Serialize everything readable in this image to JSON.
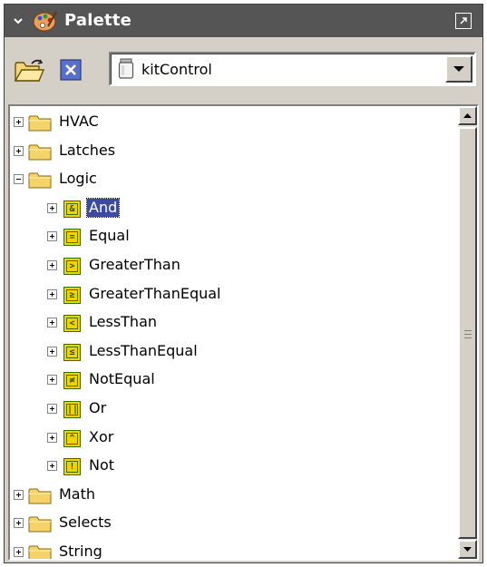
{
  "title_bar": {
    "title": "Palette"
  },
  "toolbar": {
    "module_selected": "kitControl"
  },
  "tree": {
    "items": [
      {
        "label": "HVAC",
        "type": "folder",
        "level": 0,
        "expanded": false
      },
      {
        "label": "Latches",
        "type": "folder",
        "level": 0,
        "expanded": false
      },
      {
        "label": "Logic",
        "type": "folder",
        "level": 0,
        "expanded": true
      },
      {
        "label": "And",
        "type": "component",
        "level": 1,
        "glyph": "&",
        "selected": true
      },
      {
        "label": "Equal",
        "type": "component",
        "level": 1,
        "glyph": "="
      },
      {
        "label": "GreaterThan",
        "type": "component",
        "level": 1,
        "glyph": ">"
      },
      {
        "label": "GreaterThanEqual",
        "type": "component",
        "level": 1,
        "glyph": "≥"
      },
      {
        "label": "LessThan",
        "type": "component",
        "level": 1,
        "glyph": "<"
      },
      {
        "label": "LessThanEqual",
        "type": "component",
        "level": 1,
        "glyph": "≤"
      },
      {
        "label": "NotEqual",
        "type": "component",
        "level": 1,
        "glyph": "≠"
      },
      {
        "label": "Or",
        "type": "component",
        "level": 1,
        "glyph": "||"
      },
      {
        "label": "Xor",
        "type": "component",
        "level": 1,
        "glyph": "^"
      },
      {
        "label": "Not",
        "type": "component",
        "level": 1,
        "glyph": "!"
      },
      {
        "label": "Math",
        "type": "folder",
        "level": 0,
        "expanded": false
      },
      {
        "label": "Selects",
        "type": "folder",
        "level": 0,
        "expanded": false
      },
      {
        "label": "String",
        "type": "folder",
        "level": 0,
        "expanded": false
      }
    ]
  },
  "colors": {
    "titlebar": "#555555",
    "panel": "#d4d0c8",
    "selection": "#3c4b9e",
    "folder": "#f5d36a",
    "component_icon": "#f2d200"
  },
  "icons": {
    "title": "palette-icon",
    "collapse": "chevron-down-icon",
    "maximize": "maximize-icon",
    "open": "open-folder-icon",
    "close": "close-icon",
    "module": "jar-icon",
    "folder": "folder-icon",
    "component": "logic-component-icon"
  }
}
